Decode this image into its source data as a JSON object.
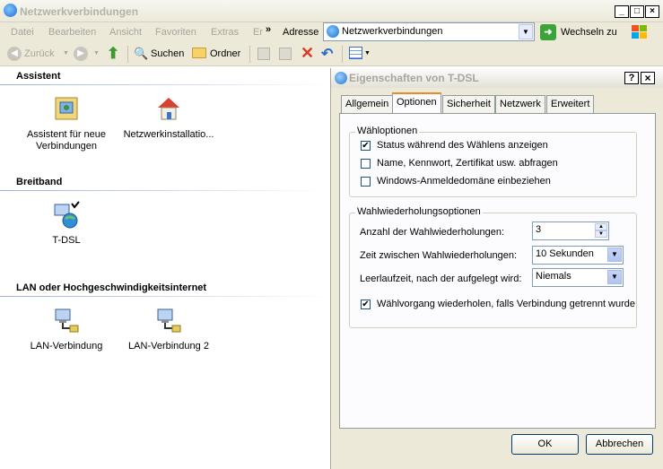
{
  "window": {
    "title": "Netzwerkverbindungen"
  },
  "menu": [
    "Datei",
    "Bearbeiten",
    "Ansicht",
    "Favoriten",
    "Extras",
    "Er",
    "»"
  ],
  "address": {
    "label": "Adresse",
    "value": "Netzwerkverbindungen",
    "go_label": "Wechseln zu"
  },
  "toolbar": {
    "back": "Zurück",
    "search": "Suchen",
    "folders": "Ordner"
  },
  "groups": [
    {
      "heading": "Assistent",
      "items": [
        {
          "label": "Assistent für neue Verbindungen",
          "icon": "wizard-icon"
        },
        {
          "label": "Netzwerkinstallatio...",
          "icon": "home-network-icon"
        }
      ]
    },
    {
      "heading": "Breitband",
      "items": [
        {
          "label": "T-DSL",
          "icon": "broadband-connection-icon"
        }
      ]
    },
    {
      "heading": "LAN oder Hochgeschwindigkeitsinternet",
      "items": [
        {
          "label": "LAN-Verbindung",
          "icon": "lan-connection-icon"
        },
        {
          "label": "LAN-Verbindung 2",
          "icon": "lan-connection-icon"
        }
      ]
    }
  ],
  "dialog": {
    "title": "Eigenschaften von T-DSL",
    "help_btn": "?",
    "close_btn": "×",
    "tabs": [
      "Allgemein",
      "Optionen",
      "Sicherheit",
      "Netzwerk",
      "Erweitert"
    ],
    "active_tab": "Optionen",
    "dial_options": {
      "legend": "Wähloptionen",
      "checks": [
        {
          "label": "Status während des Wählens anzeigen",
          "checked": true
        },
        {
          "label": "Name, Kennwort, Zertifikat usw. abfragen",
          "checked": false
        },
        {
          "label": "Windows-Anmeldedomäne einbeziehen",
          "checked": false
        }
      ]
    },
    "redial_options": {
      "legend": "Wahlwiederholungsoptionen",
      "attempts_label": "Anzahl der Wahlwiederholungen:",
      "attempts_value": "3",
      "interval_label": "Zeit zwischen Wahlwiederholungen:",
      "interval_value": "10 Sekunden",
      "idle_label": "Leerlaufzeit, nach der aufgelegt wird:",
      "idle_value": "Niemals",
      "redial_check": {
        "label": "Wählvorgang wiederholen, falls Verbindung getrennt wurde",
        "checked": true
      }
    },
    "ok": "OK",
    "cancel": "Abbrechen"
  }
}
